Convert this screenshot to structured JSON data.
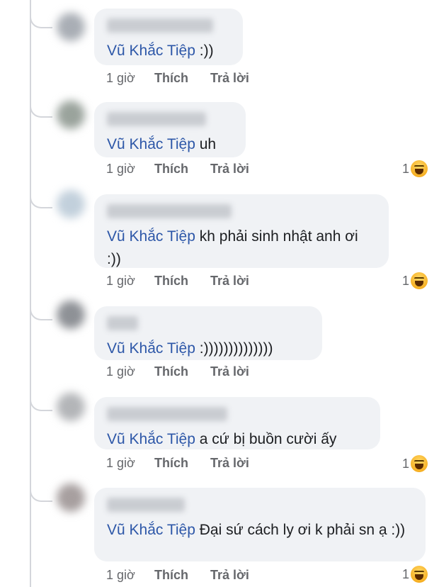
{
  "comments": [
    {
      "author_mention": "Vũ Khắc Tiệp",
      "text": " :))",
      "time": "1 giờ",
      "like": "Thích",
      "reply": "Trả lời",
      "reaction_count": "",
      "avatar_color": "#a9aeb5"
    },
    {
      "author_mention": "Vũ Khắc Tiệp",
      "text": " uh",
      "time": "1 giờ",
      "like": "Thích",
      "reply": "Trả lời",
      "reaction_count": "1",
      "avatar_color": "#9aa39c"
    },
    {
      "author_mention": "Vũ Khắc Tiệp",
      "text": " kh phải sinh nhật anh ơi :))",
      "time": "1 giờ",
      "like": "Thích",
      "reply": "Trả lời",
      "reaction_count": "1",
      "avatar_color": "#c2d0dc"
    },
    {
      "author_mention": "Vũ Khắc Tiệp",
      "text": "  :))))))))))))))",
      "time": "1 giờ",
      "like": "Thích",
      "reply": "Trả lời",
      "reaction_count": "",
      "avatar_color": "#8e9196"
    },
    {
      "author_mention": "Vũ Khắc Tiệp",
      "text": " a cứ bị buồn cười ấy",
      "time": "1 giờ",
      "like": "Thích",
      "reply": "Trả lời",
      "reaction_count": "1",
      "avatar_color": "#b3b5b8"
    },
    {
      "author_mention": "Vũ Khắc Tiệp",
      "text": " Đại sứ cách ly ơi k phải sn ạ :))",
      "time": "1 giờ",
      "like": "Thích",
      "reply": "Trả lời",
      "reaction_count": "1",
      "avatar_color": "#a79f9f"
    }
  ],
  "colors": {
    "mention": "#2d57a8",
    "bubble": "#f0f2f5",
    "meta": "#65676b"
  },
  "reaction_icon": "haha-icon"
}
